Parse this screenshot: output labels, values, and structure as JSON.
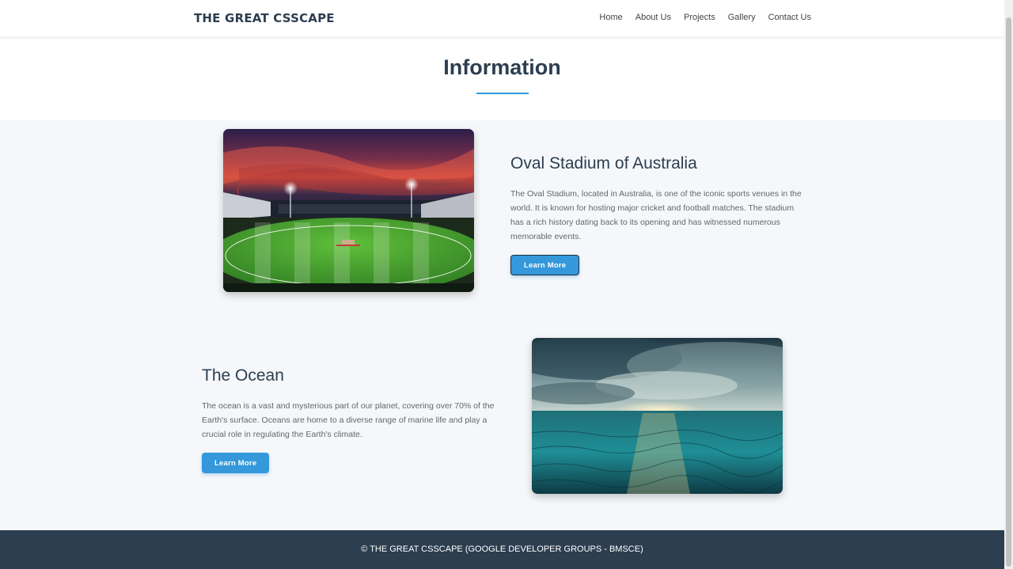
{
  "header": {
    "brand": "THE GREAT CSSCAPE",
    "nav": [
      "Home",
      "About Us",
      "Projects",
      "Gallery",
      "Contact Us"
    ]
  },
  "section": {
    "title": "Information"
  },
  "cards": [
    {
      "title": "Oval Stadium of Australia",
      "text": "The Oval Stadium, located in Australia, is one of the iconic sports venues in the world. It is known for hosting major cricket and football matches. The stadium has a rich history dating back to its opening and has witnessed numerous memorable events.",
      "button": "Learn More"
    },
    {
      "title": "The Ocean",
      "text": "The ocean is a vast and mysterious part of our planet, covering over 70% of the Earth's surface. Oceans are home to a diverse range of marine life and play a crucial role in regulating the Earth's climate.",
      "button": "Learn More"
    }
  ],
  "footer": {
    "text": "© THE GREAT CSSCAPE (GOOGLE DEVELOPER GROUPS - BMSCE)"
  },
  "colors": {
    "accent": "#3498db",
    "heading": "#2c3e50",
    "footer_bg": "#2c3e50",
    "band_bg": "#f5f7fa"
  }
}
